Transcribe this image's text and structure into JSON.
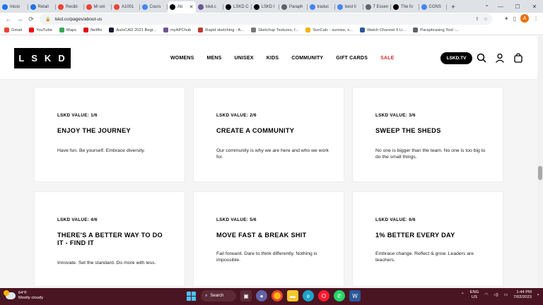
{
  "browser": {
    "tabs": [
      {
        "label": "Inicio",
        "color": "#1a73e8"
      },
      {
        "label": "Retail",
        "color": "#1a73e8"
      },
      {
        "label": "Recibi",
        "color": "#ea4335"
      },
      {
        "label": "Mi uni",
        "color": "#ea4335"
      },
      {
        "label": "A1001",
        "color": "#ea4335"
      },
      {
        "label": "Cours",
        "color": "#4285f4"
      },
      {
        "label": "Ab",
        "color": "#000000"
      },
      {
        "label": "lskd.c",
        "color": "#6e5494"
      },
      {
        "label": "LSKD C",
        "color": "#000000"
      },
      {
        "label": "LSKD I",
        "color": "#000000"
      },
      {
        "label": "Paraph",
        "color": "#5f6368"
      },
      {
        "label": "traduc",
        "color": "#4285f4"
      },
      {
        "label": "best li",
        "color": "#4285f4"
      },
      {
        "label": "7 Essen",
        "color": "#5f6368"
      },
      {
        "label": "The fo",
        "color": "#000000"
      },
      {
        "label": "CONS",
        "color": "#4285f4"
      }
    ],
    "active_tab_index": 6,
    "url": "lskd.co/pages/about-us",
    "profile_initial": "A",
    "bookmarks": [
      {
        "label": "Gmail",
        "color": "#ea4335"
      },
      {
        "label": "YouTube",
        "color": "#ff0000"
      },
      {
        "label": "Maps",
        "color": "#34a853"
      },
      {
        "label": "Netflix",
        "color": "#e50914"
      },
      {
        "label": "AutoCAD 2021 Begi...",
        "color": "#0f1a2e"
      },
      {
        "label": "myAPChub",
        "color": "#6e5494"
      },
      {
        "label": "Rapid sketching - A...",
        "color": "#c0392b"
      },
      {
        "label": "Sketchup Textures, f...",
        "color": "#777777"
      },
      {
        "label": "SunCalc - sunrise, s...",
        "color": "#f4b400"
      },
      {
        "label": "Watch Channel 9 Li...",
        "color": "#2b579a"
      },
      {
        "label": "Paraphrasing Tool -...",
        "color": "#5f6368"
      }
    ]
  },
  "site": {
    "logo": "LSKD",
    "nav": [
      "WOMENS",
      "MENS",
      "UNISEX",
      "KIDS",
      "COMMUNITY",
      "GIFT CARDS"
    ],
    "nav_sale": "SALE",
    "tv_button": "LSKD.TV"
  },
  "values": [
    {
      "label": "LSKD VALUE: 1/6",
      "title": "ENJOY THE JOURNEY",
      "desc": "Have fun. Be yourself. Embrace diversity."
    },
    {
      "label": "LSKD VALUE: 2/6",
      "title": "CREATE A COMMUNITY",
      "desc": "Our community is why we are here and who we work for."
    },
    {
      "label": "LSKD VALUE: 3/6",
      "title": "SWEEP THE SHEDS",
      "desc": "No one is bigger than the team. No one is too big to do the small things."
    },
    {
      "label": "LSKD VALUE: 4/6",
      "title": "THERE'S A BETTER WAY TO DO IT - FIND IT",
      "desc": "Innovate. Set the standard. Do more with less."
    },
    {
      "label": "LSKD VALUE: 5/6",
      "title": "MOVE FAST & BREAK SHIT",
      "desc": "Fail forward. Dare to think differently. Nothing is impossible."
    },
    {
      "label": "LSKD VALUE: 6/6",
      "title": "1% BETTER EVERY DAY",
      "desc": "Embrace change. Reflect & grow. Leaders are teachers."
    }
  ],
  "taskbar": {
    "temp": "64°F",
    "weather": "Mostly cloudy",
    "search": "Search",
    "lang1": "ENG",
    "lang2": "US",
    "time": "1:44 PM",
    "date": "7/02/2023"
  }
}
